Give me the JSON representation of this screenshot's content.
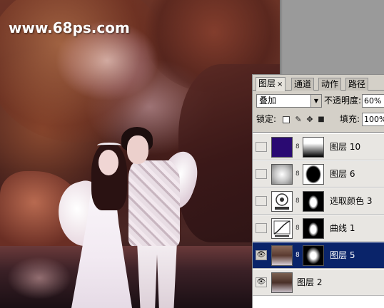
{
  "watermark": "www.68ps.com",
  "panel": {
    "tabs": [
      {
        "label": "图层",
        "close": "×",
        "active": true
      },
      {
        "label": "通道"
      },
      {
        "label": "动作"
      },
      {
        "label": "路径"
      }
    ],
    "blend_mode": "叠加",
    "opacity_label": "不透明度:",
    "opacity_value": "60%",
    "lock_label": "锁定:",
    "fill_label": "填充:",
    "fill_value": "100%",
    "layers": [
      {
        "name": "图层 10",
        "thumb_color": "#2a0a72",
        "has_mask": true,
        "visible": false,
        "selected": false
      },
      {
        "name": "图层 6",
        "has_mask": true,
        "visible": false,
        "selected": false
      },
      {
        "name": "选取颜色 3",
        "has_mask": true,
        "visible": false,
        "selected": false
      },
      {
        "name": "曲线 1",
        "has_mask": true,
        "visible": false,
        "selected": false
      },
      {
        "name": "图层 5",
        "has_mask": true,
        "visible": true,
        "selected": true
      },
      {
        "name": "图层 2",
        "has_mask": false,
        "visible": true,
        "selected": false
      }
    ]
  },
  "colors": {
    "selection": "#0a246a",
    "panel_bg": "#d4d0c8",
    "layer10_fill": "#2a0a72"
  }
}
